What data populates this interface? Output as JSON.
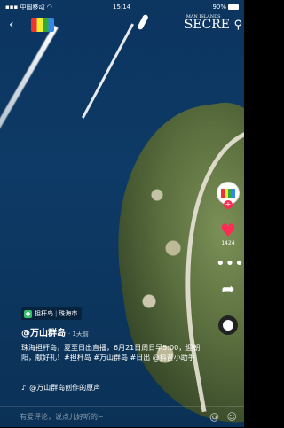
{
  "status_bar": {
    "carrier": "中国移动",
    "time": "15:14",
    "battery": "90%"
  },
  "header": {
    "brand_top": "MAN ISLANDS",
    "brand": "SECRE"
  },
  "rail": {
    "like_count": "1424"
  },
  "caption": {
    "poi_name": "担杆岛",
    "poi_city": "珠海市",
    "author": "@万山群岛",
    "time_ago": "· 1天前",
    "text": "珠海担杆岛，夏至日出直播，6月21日周日早5:00，迎朝阳，献好礼！#担杆岛 #万山群岛 #日出 @抖音小助手",
    "music": "@万山群岛创作的原声"
  },
  "comment": {
    "placeholder": "有爱评论，说点儿好听的~"
  },
  "colors": {
    "accent": "#fe2c55",
    "sea": "#0d3a66",
    "poi_icon": "#35c26b"
  },
  "icons": [
    "signal-icon",
    "wifi-icon",
    "back-icon",
    "search-icon",
    "heart-icon",
    "more-icon",
    "share-icon",
    "music-note-icon",
    "at-icon",
    "emoji-icon"
  ]
}
